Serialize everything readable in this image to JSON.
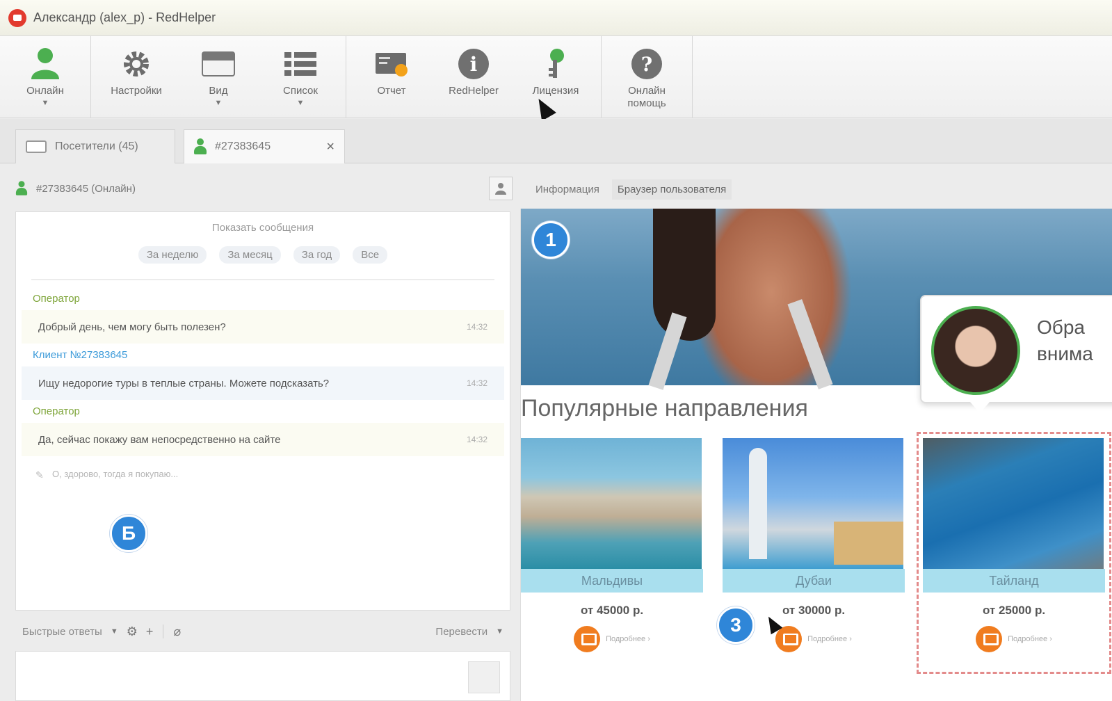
{
  "window": {
    "title": "Александр (alex_p) - RedHelper"
  },
  "toolbar": {
    "online": "Онлайн",
    "settings": "Настройки",
    "view": "Вид",
    "list": "Список",
    "report": "Отчет",
    "redhelper": "RedHelper",
    "license": "Лицензия",
    "online_help": "Онлайн помощь"
  },
  "tabs": [
    {
      "label": "Посетители (45)"
    },
    {
      "label": "#27383645"
    }
  ],
  "left": {
    "header": "#27383645 (Онлайн)",
    "show_messages": "Показать сообщения",
    "filters": [
      "За неделю",
      "За месяц",
      "За год",
      "Все"
    ],
    "messages": [
      {
        "sender": "Оператор",
        "text": "Добрый день, чем могу быть полезен?",
        "time": "14:32"
      },
      {
        "sender": "Клиент №27383645",
        "text": "Ищу недорогие туры в теплые страны. Можете подсказать?",
        "time": "14:32"
      },
      {
        "sender": "Оператор",
        "text": "Да, сейчас покажу вам непосредственно на сайте",
        "time": "14:32"
      }
    ],
    "typing": "О, здорово, тогда я покупаю...",
    "badge": "Б",
    "quick_answers": "Быстрые ответы",
    "translate": "Перевести"
  },
  "right": {
    "tab_info": "Информация",
    "tab_browser": "Браузер пользователя",
    "badge_1": "1",
    "badge_3": "3",
    "popup_text": "Обра внима",
    "section_title": "Популярные направления",
    "cards": [
      {
        "name": "Мальдивы",
        "price": "от 45000 р.",
        "more": "Подробнее ›"
      },
      {
        "name": "Дубаи",
        "price": "от 30000 р.",
        "more": "Подробнее ›"
      },
      {
        "name": "Тайланд",
        "price": "от 25000 р.",
        "more": "Подробнее ›"
      }
    ]
  },
  "colors": {
    "accent": "#2f86d8",
    "online": "#4caf50",
    "cart": "#f07c1f"
  }
}
